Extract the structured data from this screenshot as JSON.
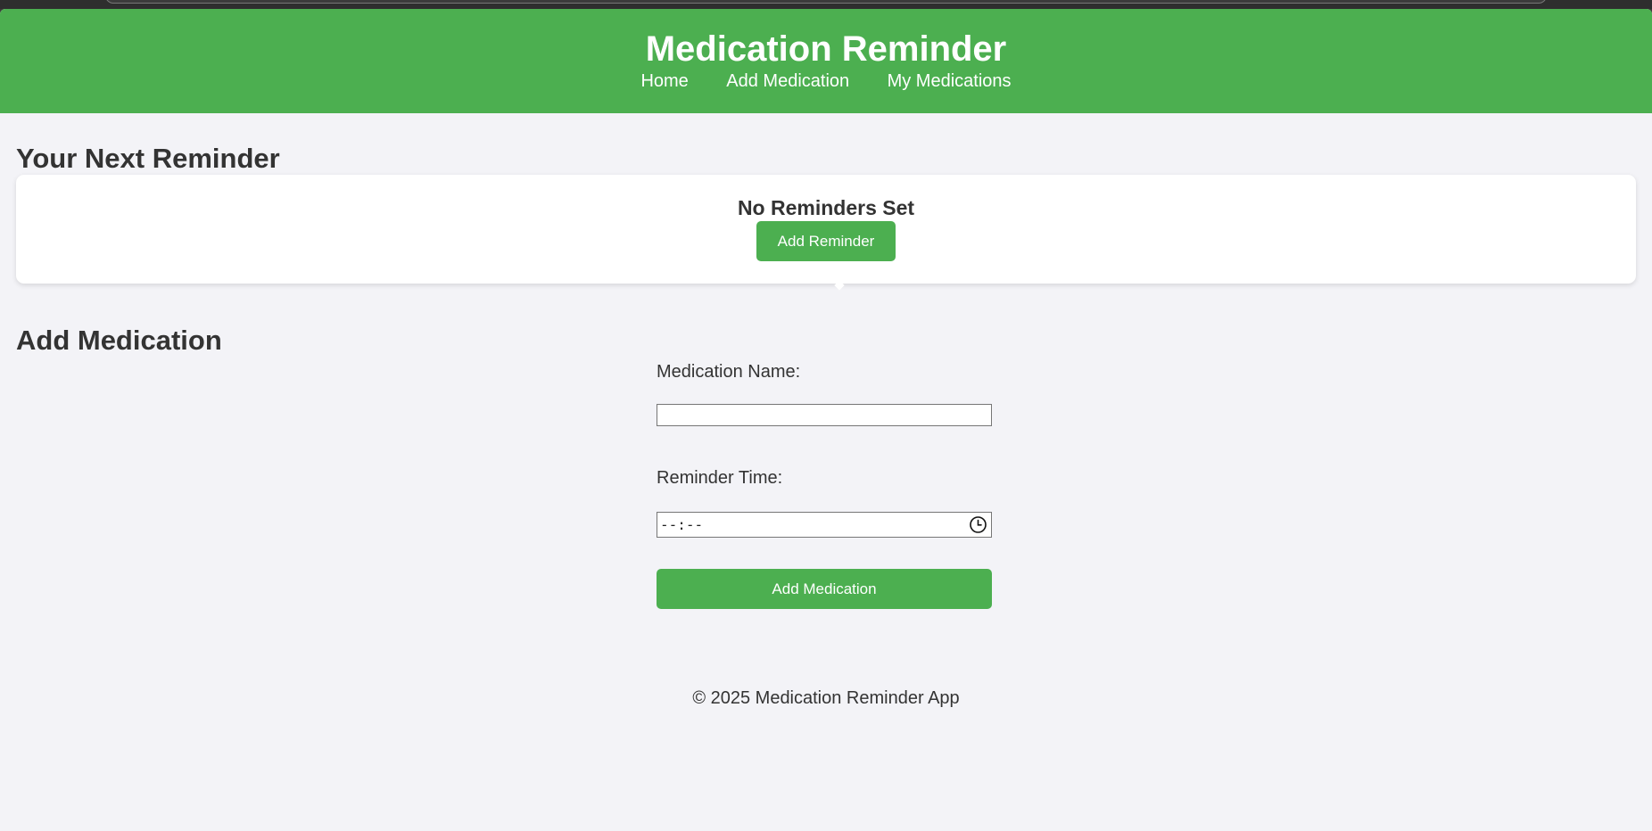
{
  "header": {
    "title": "Medication Reminder",
    "nav": [
      "Home",
      "Add Medication",
      "My Medications"
    ]
  },
  "next_reminder": {
    "section_title": "Your Next Reminder",
    "status": "No Reminders Set",
    "button_label": "Add Reminder"
  },
  "add_medication": {
    "section_title": "Add Medication",
    "name_label": "Medication Name:",
    "name_value": "",
    "time_label": "Reminder Time:",
    "time_value": "--:--",
    "submit_label": "Add Medication"
  },
  "footer": {
    "text": "© 2025 Medication Reminder App"
  },
  "colors": {
    "accent": "#4caf50",
    "background": "#f3f3f7",
    "text": "#333333"
  }
}
